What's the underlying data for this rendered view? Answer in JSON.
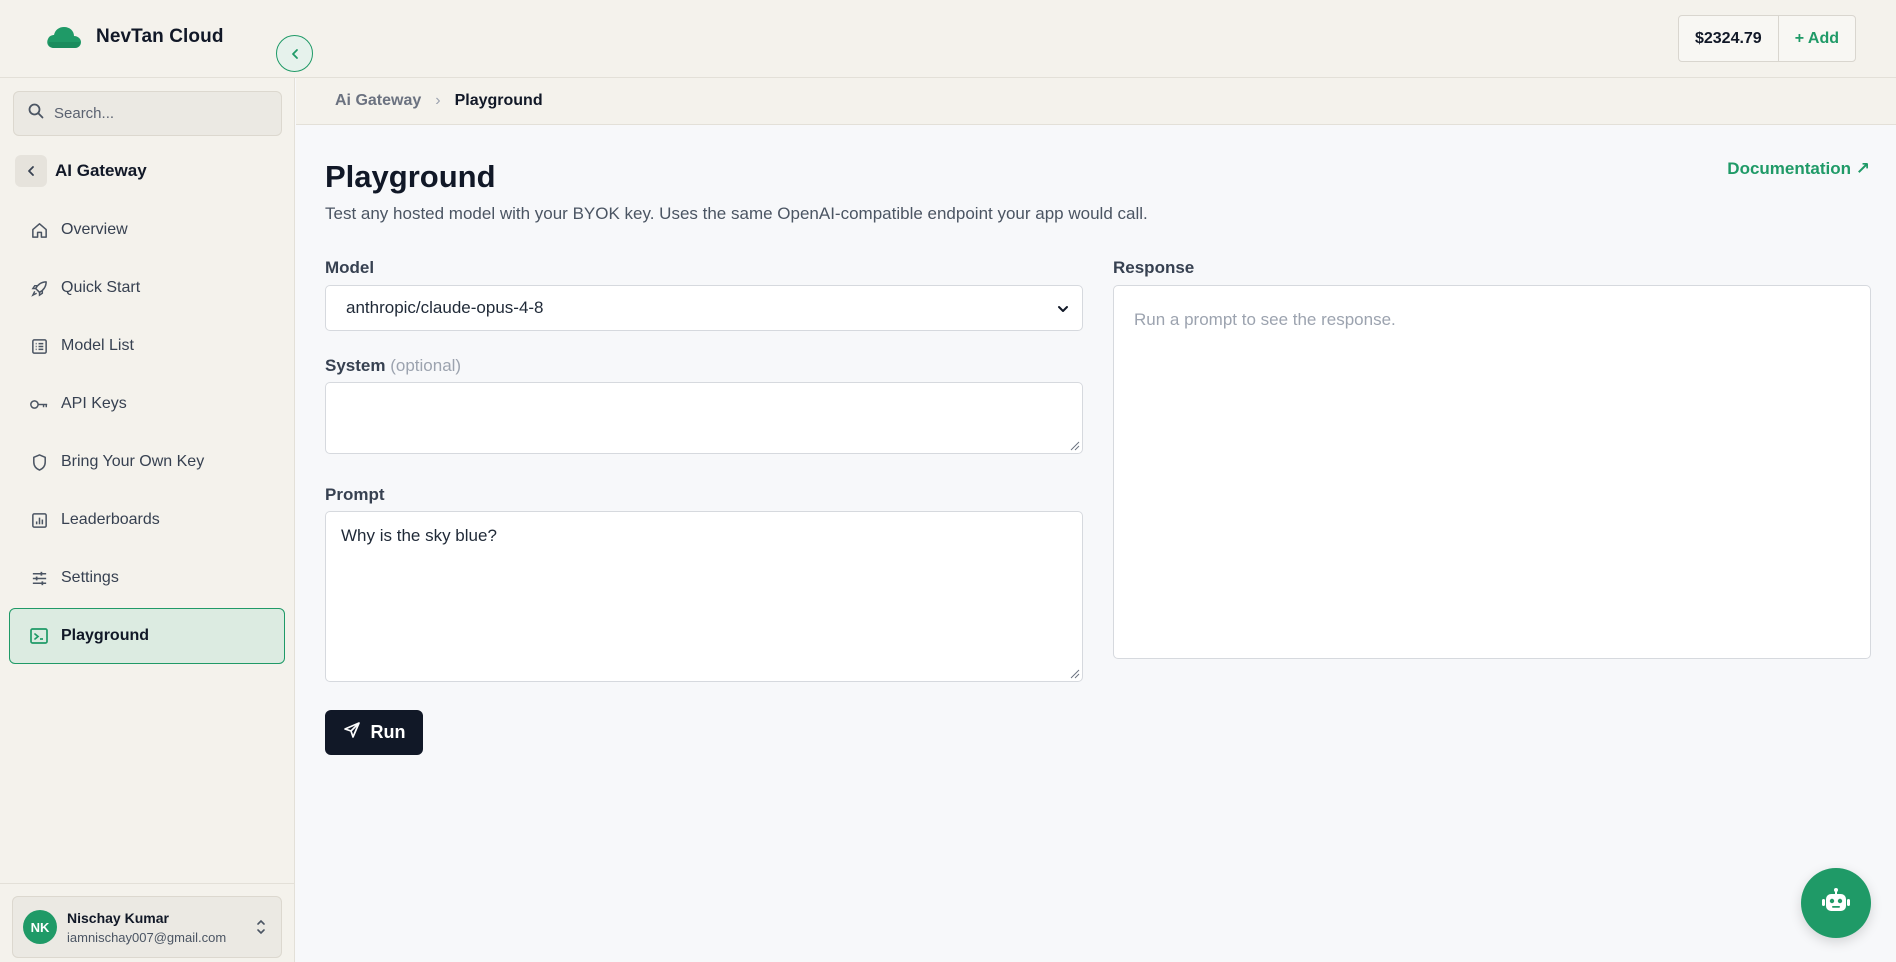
{
  "app": {
    "name": "NevTan Cloud",
    "balance": "$2324.79",
    "add_label": "+ Add"
  },
  "sidebar": {
    "search_placeholder": "Search...",
    "section_title": "AI Gateway",
    "items": [
      {
        "label": "Overview",
        "icon": "home-icon"
      },
      {
        "label": "Quick Start",
        "icon": "rocket-icon"
      },
      {
        "label": "Model List",
        "icon": "list-icon"
      },
      {
        "label": "API Keys",
        "icon": "key-icon"
      },
      {
        "label": "Bring Your Own Key",
        "icon": "shield-icon"
      },
      {
        "label": "Leaderboards",
        "icon": "chart-icon"
      },
      {
        "label": "Settings",
        "icon": "sliders-icon"
      },
      {
        "label": "Playground",
        "icon": "terminal-icon",
        "active": true
      }
    ],
    "user": {
      "initials": "NK",
      "name": "Nischay Kumar",
      "email": "iamnischay007@gmail.com"
    }
  },
  "breadcrumb": {
    "parent": "Ai Gateway",
    "separator": "›",
    "current": "Playground"
  },
  "main": {
    "title": "Playground",
    "doc_link": "Documentation ↗",
    "subtitle": "Test any hosted model with your BYOK key. Uses the same OpenAI-compatible endpoint your app would call.",
    "model_label": "Model",
    "model_value": "anthropic/claude-opus-4-8",
    "system_label": "System",
    "system_optional": "(optional)",
    "system_value": "",
    "prompt_label": "Prompt",
    "prompt_value": "Why is the sky blue?",
    "run_label": "Run",
    "response_label": "Response",
    "response_placeholder": "Run a prompt to see the response."
  },
  "colors": {
    "accent": "#1f9a67",
    "dark_button": "#111827",
    "sidebar_bg": "#f4f2ec",
    "active_item_bg": "#dcebe1"
  }
}
